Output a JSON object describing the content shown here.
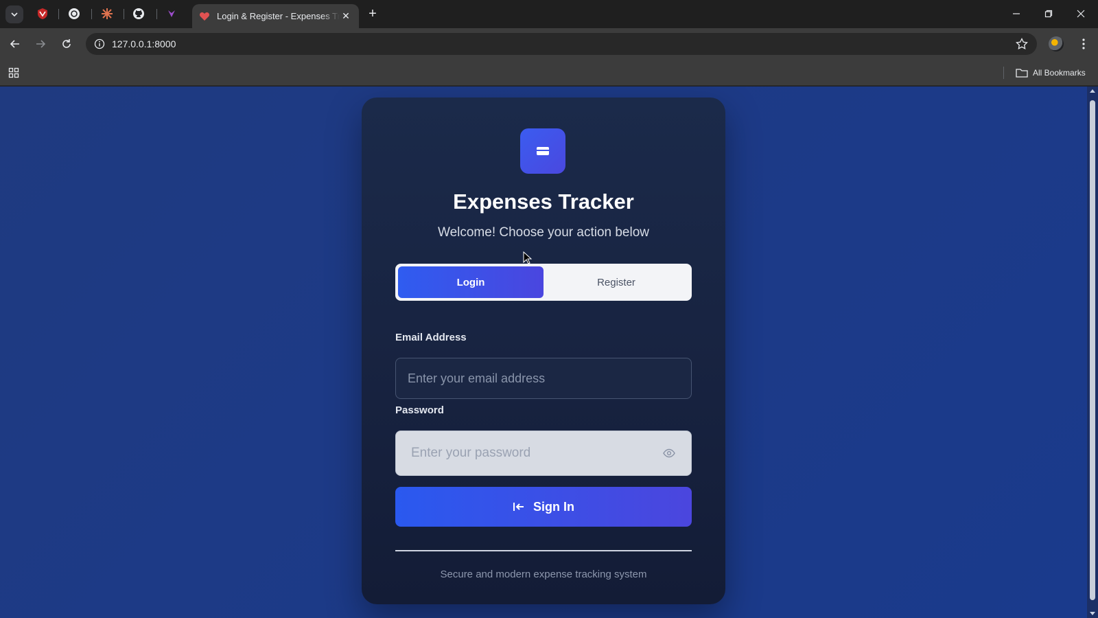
{
  "browser": {
    "active_tab": {
      "title": "Login & Register - Expenses Tracker",
      "close": "✕"
    },
    "new_tab": "+",
    "url": "127.0.0.1:8000",
    "bookmarks_label": "All Bookmarks"
  },
  "app": {
    "title": "Expenses Tracker",
    "subtitle": "Welcome! Choose your action below",
    "tabs": {
      "login": "Login",
      "register": "Register"
    },
    "email": {
      "label": "Email Address",
      "placeholder": "Enter your email address"
    },
    "password": {
      "label": "Password",
      "placeholder": "Enter your password"
    },
    "submit_label": "Sign In",
    "footer": "Secure and modern expense tracking system"
  },
  "colors": {
    "page_background": "#1d3a86",
    "card_background": "#17223f",
    "accent": "#3b55e8",
    "toggle_background": "#f3f4f7"
  },
  "icons": {
    "logo": "credit-card-icon",
    "password_toggle": "eye-icon",
    "submit": "sign-in-icon"
  }
}
